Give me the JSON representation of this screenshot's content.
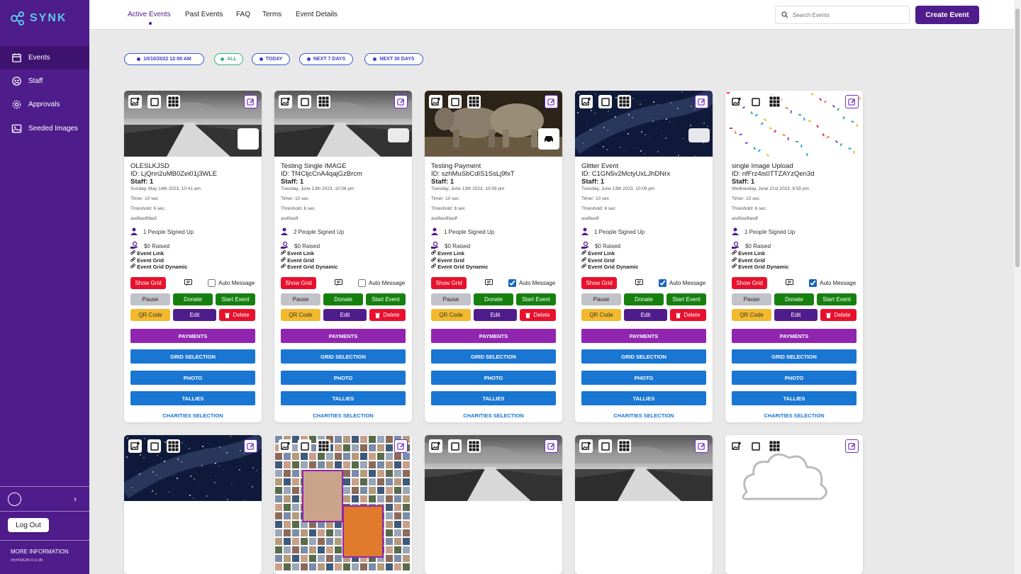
{
  "app": {
    "logo_text": "SYNK"
  },
  "sidebar": {
    "items": [
      {
        "label": "Events",
        "icon": "calendar-icon"
      },
      {
        "label": "Staff",
        "icon": "staff-icon"
      },
      {
        "label": "Approvals",
        "icon": "gear-icon"
      },
      {
        "label": "Seeded Images",
        "icon": "image-icon"
      }
    ],
    "logout_label": "Log Out",
    "more_info": "MORE INFORMATION",
    "version": "VERSION 0.0.36"
  },
  "header": {
    "tabs": [
      "Active Events",
      "Past Events",
      "FAQ",
      "Terms",
      "Event Details"
    ],
    "search_placeholder": "Search Events",
    "create_label": "Create Event"
  },
  "filters": [
    "10/10/2022 12:00 AM",
    "ALL",
    "TODAY",
    "NEXT 7 DAYS",
    "NEXT 30 DAYS"
  ],
  "labels": {
    "show_grid": "Show Grid",
    "auto_message": "Auto Message",
    "pause": "Pause",
    "donate": "Donate",
    "start_event": "Start Event",
    "qr_code": "QR Code",
    "edit": "Edit",
    "delete": "Delete",
    "payments": "PAYMENTS",
    "grid_selection": "GRID SELECTION",
    "photo": "PHOTO",
    "tallies": "TALLIES",
    "charities": "CHARITIES SELECTION",
    "event_link": "Event Link",
    "event_grid": "Event Grid",
    "event_grid_dynamic": "Event Grid Dynamic"
  },
  "events": [
    {
      "name": "OLESLKJSD",
      "id": "ID: LjQnn2uMB0Zei01j3WLE",
      "staff": "Staff: 1",
      "date": "Sunday, May 14th 2023, 10:41 am",
      "timer": "Timer: 10 sec",
      "threshold": "Threshold: 6 sec",
      "desc": "asdfasdfdasf",
      "signed": "1 People Signed Up",
      "raised": "$0 Raised",
      "auto_message": false
    },
    {
      "name": "Testing Single IMAGE",
      "id": "ID: Tf4CljcCnA4qajGzBrcm",
      "staff": "Staff: 1",
      "date": "Tuesday, June 13th 2023, 10:08 pm",
      "timer": "Timer: 10 sec",
      "threshold": "Threshold: 6 sec",
      "desc": "asdfasdf",
      "signed": "2 People Signed Up",
      "raised": "$0 Raised",
      "auto_message": false
    },
    {
      "name": "Testing Payment",
      "id": "ID: szhMuSbCdIS1SsLj9fxT",
      "staff": "Staff: 1",
      "date": "Tuesday, June 13th 2023, 10:09 pm",
      "timer": "Timer: 10 sec",
      "threshold": "Threshold: 6 sec",
      "desc": "asdfasdfasdf",
      "signed": "1 People Signed Up",
      "raised": "$0 Raised",
      "auto_message": true
    },
    {
      "name": "Glitter Event",
      "id": "ID: C1GN5v2MctyUxLJhDNrx",
      "staff": "Staff: 1",
      "date": "Tuesday, June 13th 2023, 10:09 pm",
      "timer": "Timer: 10 sec",
      "threshold": "Threshold: 6 sec",
      "desc": "asdfasdf",
      "signed": "1 People Signed Up",
      "raised": "$0 Raised",
      "auto_message": true
    },
    {
      "name": "single Image Upload",
      "id": "ID: nfFrz4is0TTZAYzQen3d",
      "staff": "Staff: 1",
      "date": "Wednesday, June 21st 2023, 8:55 pm",
      "timer": "Timer: 10 sec",
      "threshold": "Threshold: 6 sec",
      "desc": "asdfasdfasdf",
      "signed": "1 People Signed Up",
      "raised": "$0 Raised",
      "auto_message": true
    }
  ],
  "colors": {
    "brand": "#4f1c8c",
    "red": "#e8112d",
    "green": "#16800f",
    "purple": "#9025b0",
    "blue": "#1976d2",
    "yellow": "#f2b92d"
  }
}
